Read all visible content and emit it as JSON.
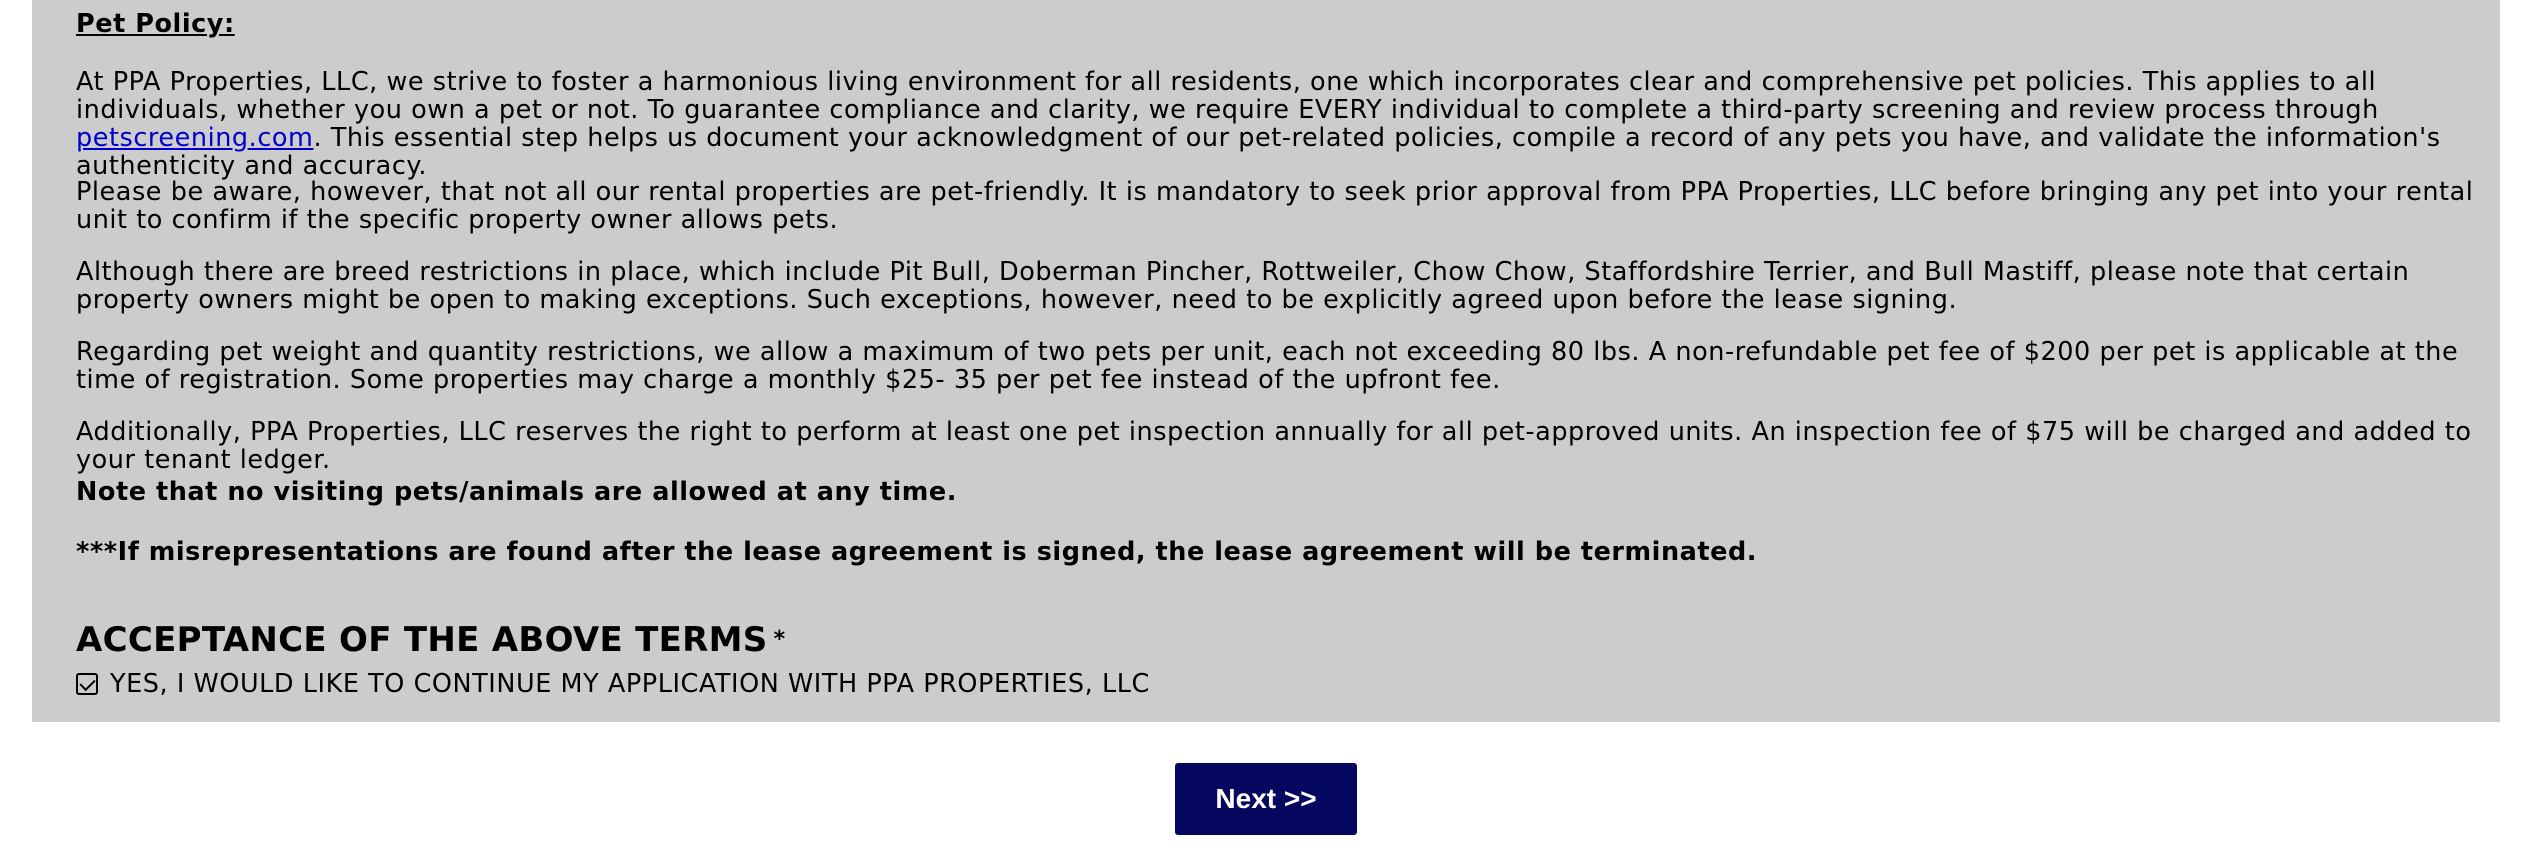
{
  "policy": {
    "heading": "Pet Policy:",
    "p1_before_link": "At PPA Properties, LLC, we strive to foster a harmonious living environment for all residents, one which incorporates clear and comprehensive pet policies. This applies to all individuals, whether you own a pet or not. To guarantee compliance and clarity, we require EVERY individual to complete a third-party screening and review process through ",
    "p1_link": "petscreening.com",
    "p1_after_link": ". This essential step helps us document your acknowledgment of our pet-related policies, compile a record of any pets you have, and validate the information's authenticity and accuracy.",
    "p2": "Please be aware, however, that not all our rental properties are pet-friendly. It is mandatory to seek prior approval from PPA Properties, LLC before bringing any pet into your rental unit to confirm if the specific property owner allows pets.",
    "p3": "Although there are breed restrictions in place, which include Pit Bull, Doberman Pincher, Rottweiler, Chow Chow, Staffordshire Terrier, and Bull Mastiff, please note that certain property owners might be open to making exceptions. Such exceptions, however, need to be explicitly agreed upon before the lease signing.",
    "p4": "Regarding pet weight and quantity restrictions, we allow a maximum of two pets per unit, each not exceeding 80 lbs. A non-refundable pet fee of $200 per pet is applicable at the time of registration. Some properties may charge a monthly $25- 35 per pet fee instead of the upfront fee.",
    "p5": "Additionally, PPA Properties, LLC reserves the right to perform at least one pet inspection annually for all pet-approved units. An inspection fee of $75 will be charged and added to your tenant ledger.",
    "note1": "Note that no visiting pets/animals are allowed at any time.",
    "note2": "***If misrepresentations are found after the lease agreement is signed, the lease agreement will be terminated."
  },
  "acceptance": {
    "title": "ACCEPTANCE OF THE ABOVE TERMS",
    "required_mark": "*",
    "checkbox_label": "YES, I WOULD LIKE TO CONTINUE MY APPLICATION WITH PPA PROPERTIES, LLC",
    "checked": true
  },
  "buttons": {
    "next_label": "Next >>"
  },
  "colors": {
    "panel_bg": "#cccccc",
    "button_bg": "#06075e",
    "link": "#0000cc"
  }
}
